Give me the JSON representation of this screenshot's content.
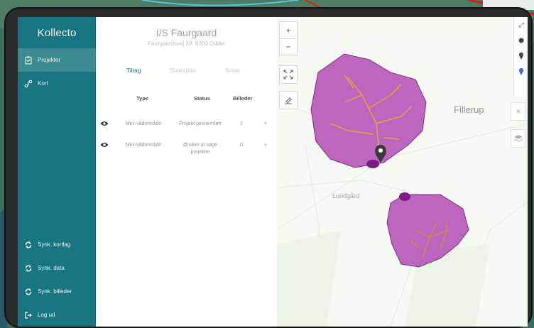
{
  "app": {
    "brand": "Kollecto"
  },
  "sidebar": {
    "items": [
      {
        "label": "Projekter",
        "icon": "clipboard-icon",
        "active": true
      },
      {
        "label": "Kort",
        "icon": "map-route-icon",
        "active": false
      }
    ],
    "bottom_items": [
      {
        "label": "Synk. kortlag",
        "icon": "sync-icon"
      },
      {
        "label": "Synk. data",
        "icon": "sync-icon"
      },
      {
        "label": "Synk. billeder",
        "icon": "sync-icon"
      },
      {
        "label": "Log ud",
        "icon": "logout-icon"
      }
    ]
  },
  "project": {
    "title": "I/S Faurgaard",
    "address": "Faurgaardsvej 30, 8300 Odder",
    "tabs": [
      {
        "label": "Tiltag",
        "active": true
      },
      {
        "label": "Stamdata",
        "active": false
      },
      {
        "label": "Notat",
        "active": false
      }
    ],
    "table": {
      "headers": {
        "type": "Type",
        "status": "Status",
        "images": "Billeder"
      },
      "rows": [
        {
          "type": "Mini-vådområde",
          "status": "Projekt gennemført",
          "images": "2",
          "remove": "×"
        },
        {
          "type": "Mini-vådområde",
          "status_line1": "Ønsker at søge",
          "status_line2": "projektet",
          "images": "0",
          "remove": "×"
        }
      ]
    }
  },
  "map": {
    "zoom_in": "+",
    "zoom_out": "−",
    "labels": {
      "place1": "Fillerup",
      "place2": "Lundgård"
    },
    "right_tools": [
      "expand-icon",
      "hexagon-icon",
      "pin-icon",
      "location-pin-icon"
    ],
    "side_buttons": [
      "close-icon",
      "layers-icon"
    ],
    "colors": {
      "area_fill": "#b24bb5",
      "drain_line": "#e39a52",
      "accent": "#17767f"
    }
  }
}
